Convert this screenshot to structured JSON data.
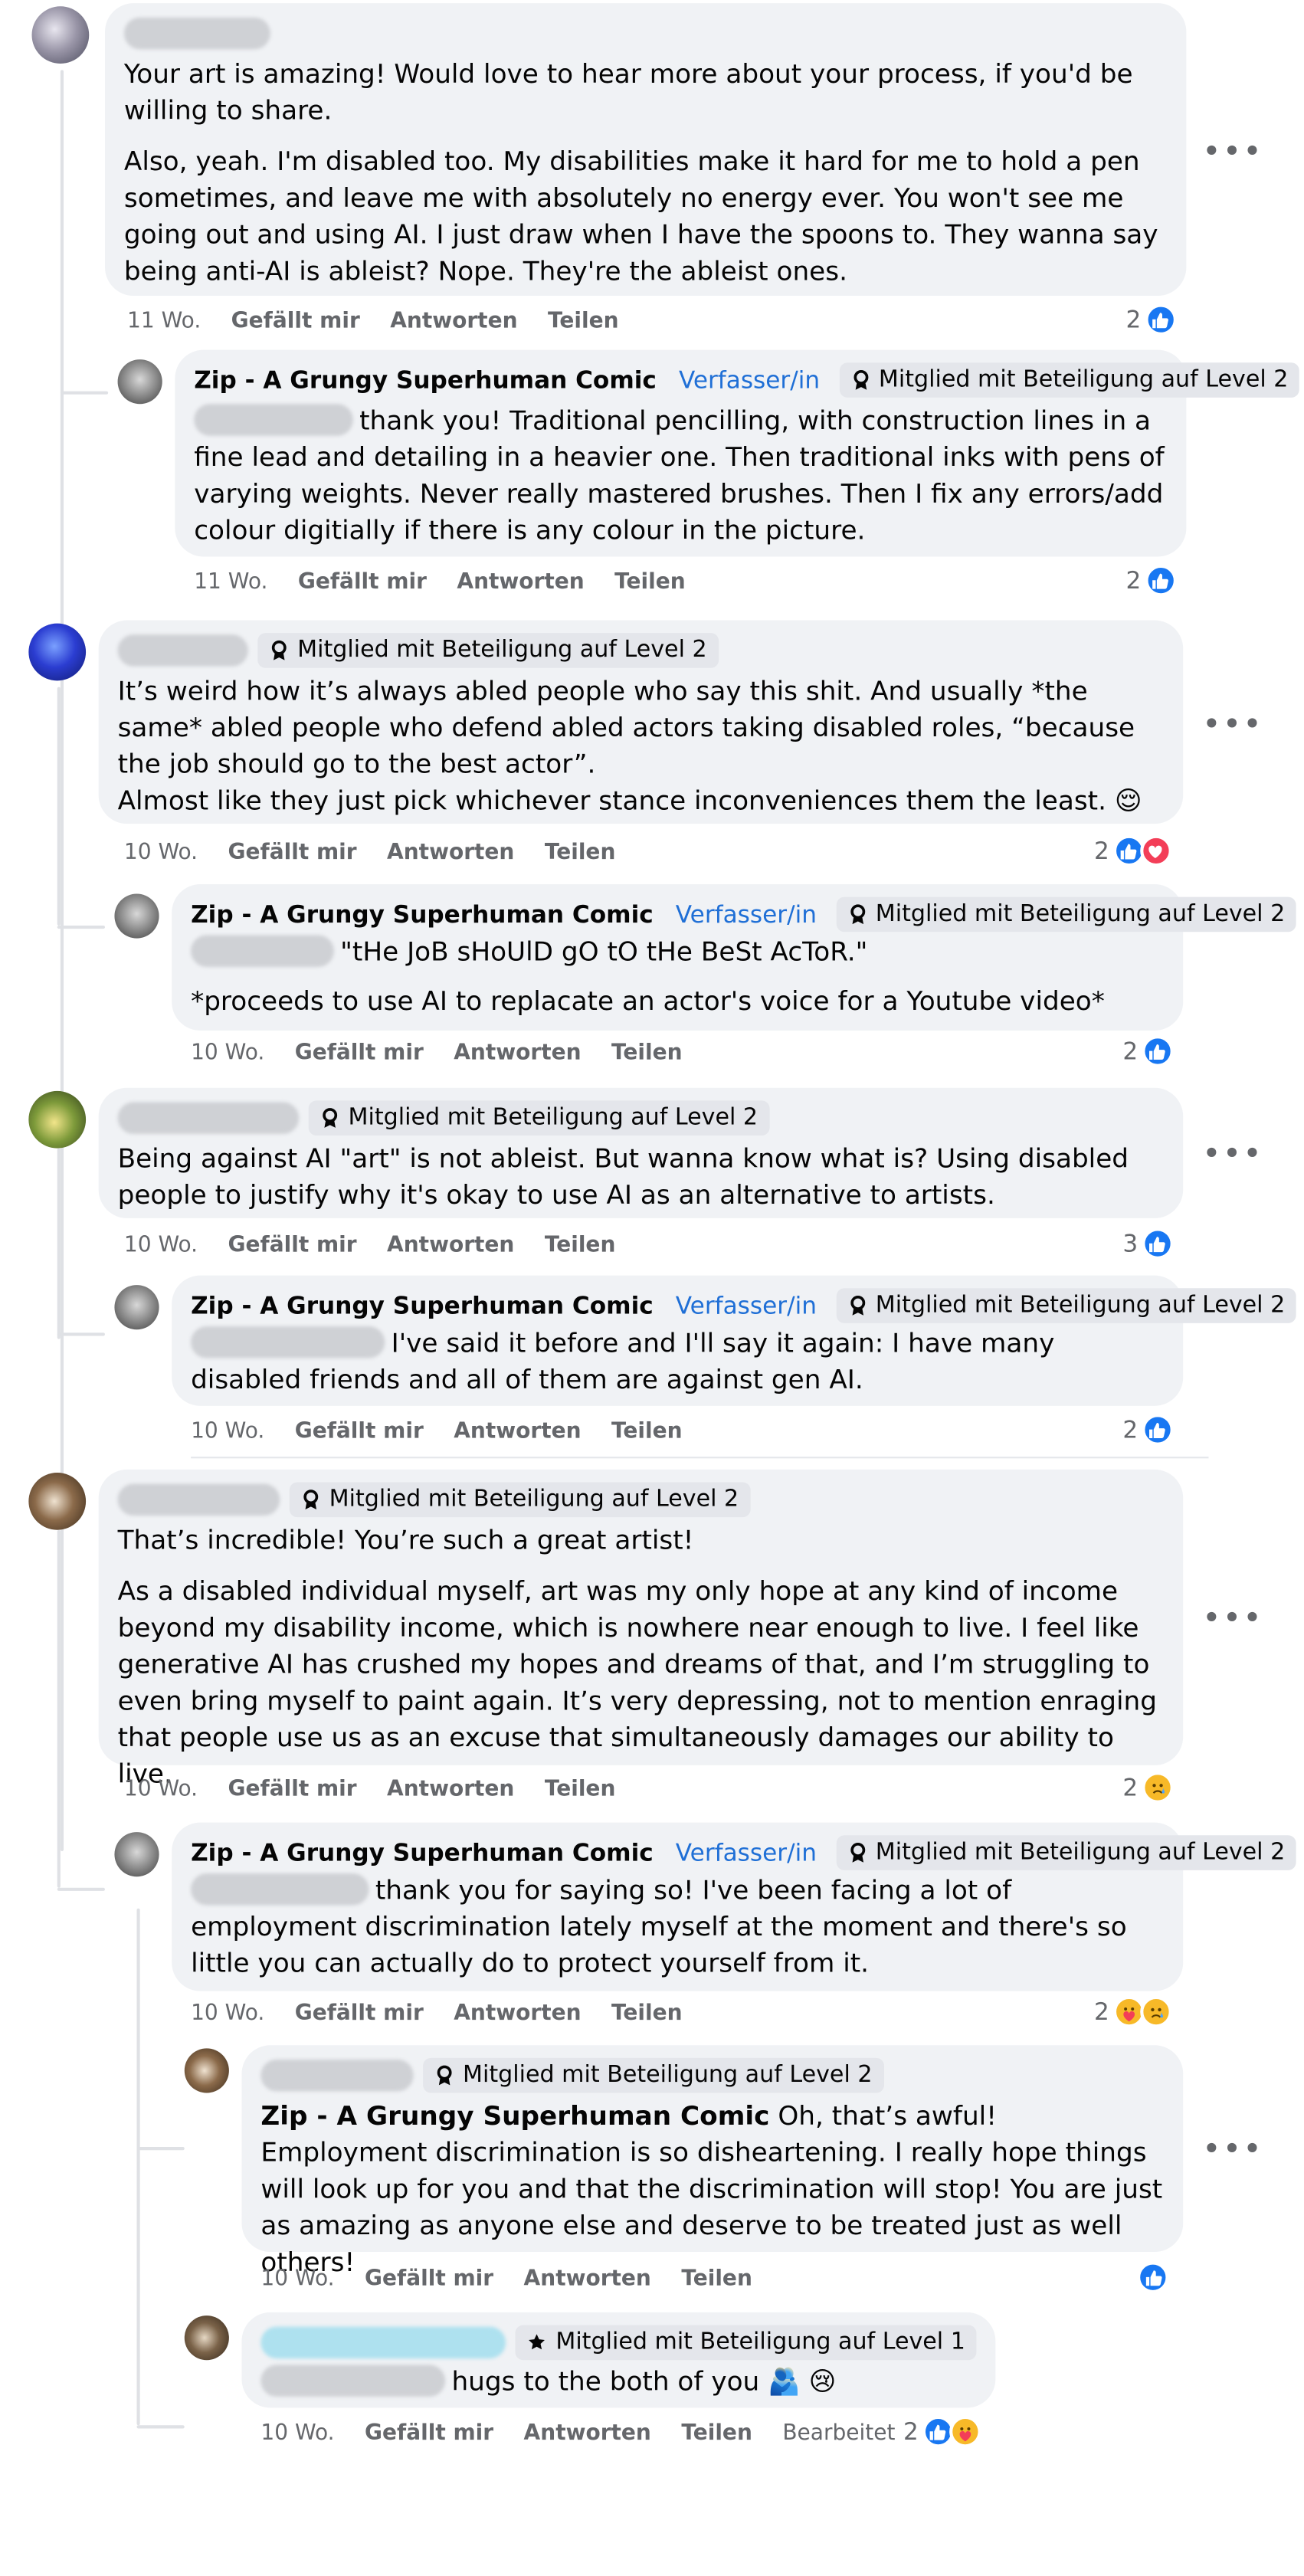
{
  "labels": {
    "like": "Gefällt mir",
    "reply": "Antworten",
    "share": "Teilen",
    "edited": "Bearbeitet",
    "author_badge": "Verfasser/in",
    "page_name": "Zip - A Grungy Superhuman Comic",
    "level2": "Mitglied mit Beteiligung auf Level 2",
    "level1": "Mitglied mit Beteiligung auf Level 1"
  },
  "comments": [
    {
      "text1": "Your art is amazing! Would love to hear more about your process, if you'd be willing to share.",
      "text2": "Also, yeah. I'm disabled too. My disabilities make it hard for me to hold a pen sometimes, and leave me with absolutely no energy ever. You won't see me going out and using AI. I just draw when I have the spoons to. They wanna say being anti-AI is ableist? Nope. They're the ableist ones.",
      "time": "11 Wo.",
      "reaction_count": "2"
    },
    {
      "text1": "thank you! Traditional pencilling, with construction lines in a fine lead and detailing in a heavier one. Then traditional inks with pens of varying weights. Never really mastered brushes. Then I fix any errors/add colour digitially if there is any colour in the picture.",
      "time": "11 Wo.",
      "reaction_count": "2"
    },
    {
      "text1": "It’s weird how it’s always abled people who say this shit. And usually *the same* abled people who defend abled actors taking disabled roles, “because the job should go to the best actor”.",
      "text2": "Almost like they just pick whichever stance inconveniences them the least. 😌",
      "time": "10 Wo.",
      "reaction_count": "2"
    },
    {
      "text1": "\"tHe JoB sHoUlD gO tO tHe BeSt AcToR.\"",
      "text2": "*proceeds to use AI to replacate an actor's voice for a Youtube video*",
      "time": "10 Wo.",
      "reaction_count": "2"
    },
    {
      "text1": "Being against AI \"art\" is not ableist. But wanna know what is? Using disabled people to justify why it's okay to use AI as an alternative to artists.",
      "time": "10 Wo.",
      "reaction_count": "3"
    },
    {
      "text1": "I've said it before and I'll say it again: I have many disabled friends and all of them are against gen AI.",
      "time": "10 Wo.",
      "reaction_count": "2"
    },
    {
      "text1": "That’s incredible! You’re such a great artist!",
      "text2": "As a disabled individual myself, art was my only hope at any kind of income beyond my disability income, which is nowhere near enough to live. I feel like generative AI has crushed my hopes and dreams of that, and I’m struggling to even bring myself to paint again. It’s very depressing, not to mention enraging that people use us as an excuse that simultaneously damages our ability to live.",
      "time": "10 Wo.",
      "reaction_count": "2"
    },
    {
      "text1": "thank you for saying so! I've been facing a lot of employment discrimination lately myself at the moment and there's so little you can actually do to protect yourself from it.",
      "time": "10 Wo.",
      "reaction_count": "2"
    },
    {
      "mention": "Zip - A Grungy Superhuman Comic",
      "text1": "Oh, that’s awful! Employment discrimination is so disheartening. I really hope things will look up for you and that the discrimination will stop! You are just as amazing as anyone else and deserve to be treated just as well others!",
      "time": "10 Wo."
    },
    {
      "text1": "hugs to the both of you",
      "time": "10 Wo.",
      "reaction_count": "2"
    }
  ],
  "colors": {
    "bubble": "#f0f2f5",
    "like": "#1877f2",
    "love": "#f33e58",
    "author_badge": "#1f6fd6",
    "meta": "#65676b"
  },
  "icons": [
    "like-icon",
    "love-icon",
    "sad-icon",
    "care-icon",
    "badge-icon",
    "star-badge-icon",
    "more-icon"
  ]
}
